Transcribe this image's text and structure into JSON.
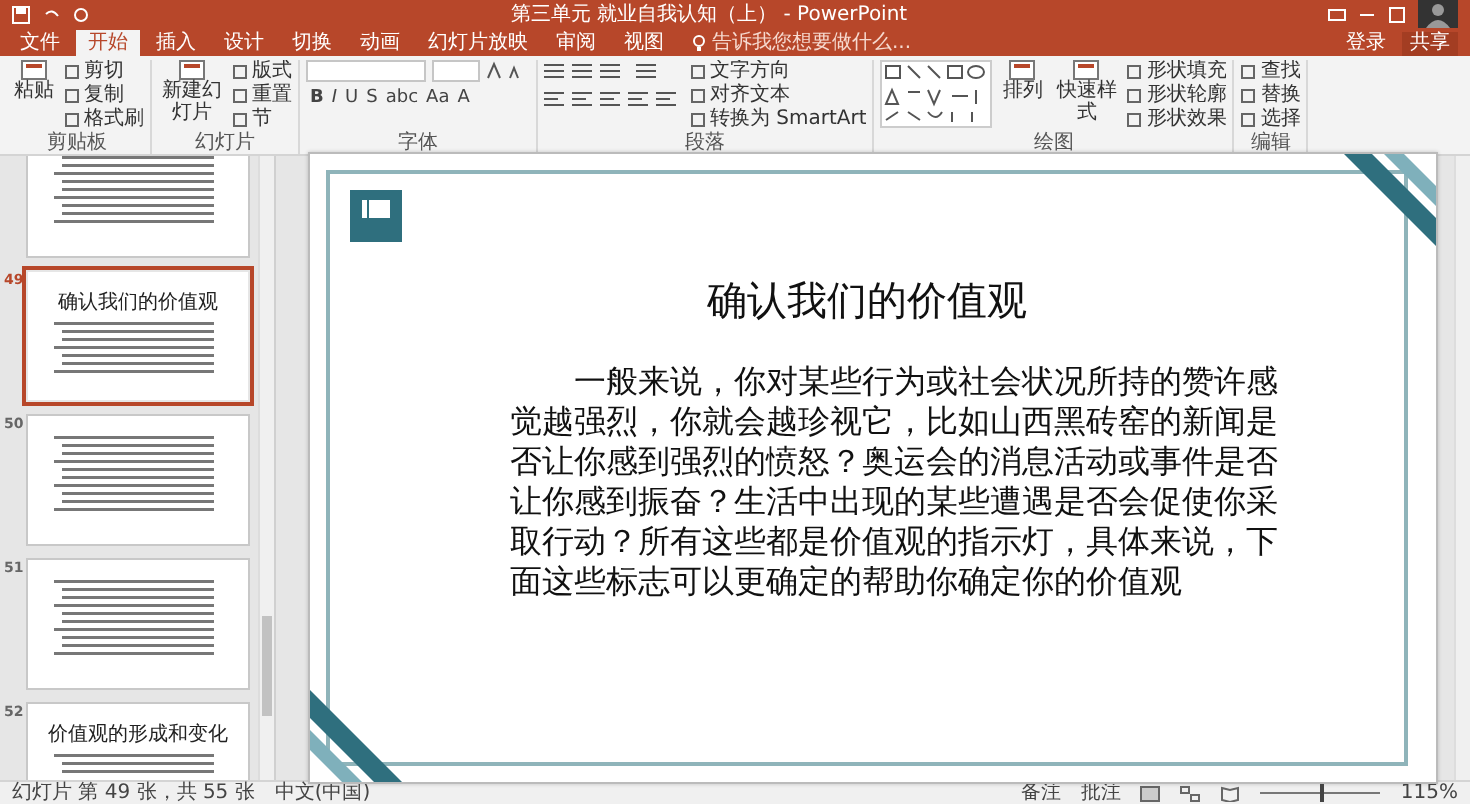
{
  "window": {
    "title": "第三单元 就业自我认知（上） - PowerPoint"
  },
  "account": {
    "sign_in": "登录",
    "share": "共享"
  },
  "tabs": [
    {
      "label": "文件",
      "selected": false
    },
    {
      "label": "开始",
      "selected": true
    },
    {
      "label": "插入",
      "selected": false
    },
    {
      "label": "设计",
      "selected": false
    },
    {
      "label": "切换",
      "selected": false
    },
    {
      "label": "动画",
      "selected": false
    },
    {
      "label": "幻灯片放映",
      "selected": false
    },
    {
      "label": "审阅",
      "selected": false
    },
    {
      "label": "视图",
      "selected": false
    }
  ],
  "tell_me": {
    "placeholder": "告诉我您想要做什么..."
  },
  "ribbon": {
    "groups": [
      {
        "label": "剪贴板",
        "columns": [
          [
            {
              "kind": "large",
              "label": "粘贴"
            }
          ],
          [
            {
              "kind": "small",
              "label": "剪切"
            },
            {
              "kind": "small",
              "label": "复制"
            },
            {
              "kind": "small",
              "label": "格式刷"
            }
          ]
        ]
      },
      {
        "label": "幻灯片",
        "columns": [
          [
            {
              "kind": "large",
              "label": "新建幻灯片"
            }
          ],
          [
            {
              "kind": "small",
              "label": "版式"
            },
            {
              "kind": "small",
              "label": "重置"
            },
            {
              "kind": "small",
              "label": "节"
            }
          ]
        ]
      },
      {
        "label": "字体",
        "columns": [
          [
            {
              "kind": "font_fields"
            },
            {
              "kind": "glyphs",
              "labels": [
                "B",
                "I",
                "U",
                "S",
                "abc",
                "Aa",
                "A"
              ]
            }
          ]
        ]
      },
      {
        "label": "段落",
        "columns": [
          [
            {
              "kind": "para_icons"
            }
          ],
          [
            {
              "kind": "small",
              "label": "文字方向"
            },
            {
              "kind": "small",
              "label": "对齐文本"
            },
            {
              "kind": "small",
              "label": "转换为 SmartArt"
            }
          ]
        ]
      },
      {
        "label": "绘图",
        "columns": [
          [
            {
              "kind": "shapes"
            }
          ],
          [
            {
              "kind": "large",
              "label": "排列"
            }
          ],
          [
            {
              "kind": "large",
              "label": "快速样式"
            }
          ],
          [
            {
              "kind": "small",
              "label": "形状填充"
            },
            {
              "kind": "small",
              "label": "形状轮廓"
            },
            {
              "kind": "small",
              "label": "形状效果"
            }
          ]
        ]
      },
      {
        "label": "编辑",
        "columns": [
          [
            {
              "kind": "small",
              "label": "查找"
            },
            {
              "kind": "small",
              "label": "替换"
            },
            {
              "kind": "small",
              "label": "选择"
            }
          ]
        ]
      }
    ]
  },
  "thumbnails": [
    {
      "kind": "bullets",
      "selected": false
    },
    {
      "number": "49",
      "kind": "title_text",
      "title": "确认我们的价值观",
      "selected": true
    },
    {
      "number": "50",
      "kind": "bullets",
      "selected": false
    },
    {
      "number": "51",
      "kind": "bullets",
      "selected": false
    },
    {
      "number": "52",
      "kind": "title_bullets",
      "title": "价值观的形成和变化",
      "selected": false
    }
  ],
  "slide": {
    "title": "确认我们的价值观",
    "body": "一般来说，你对某些行为或社会状况所持的赞许感觉越强烈，你就会越珍视它，比如山西黑砖窑的新闻是否让你感到强烈的愤怒？奥运会的消息活动或事件是否让你感到振奋？生活中出现的某些遭遇是否会促使你采取行动？所有这些都是价值观的指示灯，具体来说，下面这些标志可以更确定的帮助你确定你的价值观"
  },
  "status_bar": {
    "slide_count": "幻灯片 第 49 张，共 55 张",
    "language": "中文(中国)",
    "notes": "备注",
    "comments": "批注",
    "zoom": "115%",
    "zoom_slider": {
      "level": 0.5
    }
  }
}
